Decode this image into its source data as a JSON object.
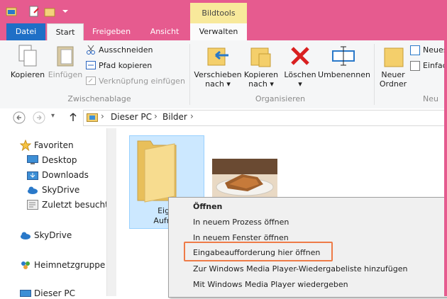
{
  "titlebar": {
    "context_tab": "Bildtools"
  },
  "tabs": {
    "datei": "Datei",
    "start": "Start",
    "freigeben": "Freigeben",
    "ansicht": "Ansicht",
    "verwalten": "Verwalten"
  },
  "ribbon": {
    "kopieren": "Kopieren",
    "einfuegen": "Einfügen",
    "ausschneiden": "Ausschneiden",
    "pfad_kopieren": "Pfad kopieren",
    "verknuepfung": "Verknüpfung einfügen",
    "group_clipboard": "Zwischenablage",
    "verschieben_1": "Verschieben",
    "verschieben_2": "nach",
    "kopieren_nach_1": "Kopieren",
    "kopieren_nach_2": "nach",
    "loeschen": "Löschen",
    "umbenennen": "Umbenennen",
    "group_organize": "Organisieren",
    "neuer_ordner_1": "Neuer",
    "neuer_ordner_2": "Ordner",
    "neues": "Neues",
    "einfach": "Einfach",
    "group_new": "Neu"
  },
  "address": {
    "crumb1": "Dieser PC",
    "crumb2": "Bilder"
  },
  "nav": {
    "favoriten": "Favoriten",
    "desktop": "Desktop",
    "downloads": "Downloads",
    "skydrive_fav": "SkyDrive",
    "zuletzt": "Zuletzt besucht",
    "skydrive": "SkyDrive",
    "heimnetz": "Heimnetzgruppe",
    "dieserpc": "Dieser PC"
  },
  "content": {
    "folder_line1": "Eige",
    "folder_line2": "Aufnal"
  },
  "context_menu": {
    "items": [
      "Öffnen",
      "In neuem Prozess öffnen",
      "In neuem Fenster öffnen",
      "Eingabeaufforderung hier öffnen",
      "Zur Windows Media Player-Wiedergabeliste hinzufügen",
      "Mit Windows Media Player wiedergeben"
    ]
  },
  "colors": {
    "title": "#e65b8f",
    "accent": "#1f6fc6",
    "highlight": "#ee7b47",
    "context": "#f8e99b"
  }
}
